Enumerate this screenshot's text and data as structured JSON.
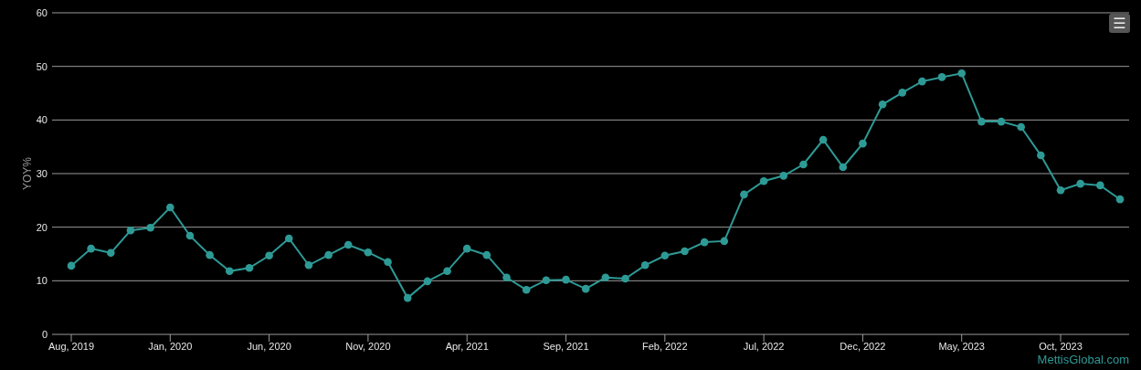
{
  "chart": {
    "menu_button": "☰",
    "credit": "MettisGlobal.com",
    "chart_data": {
      "type": "line",
      "grid": true,
      "ylabel": "YOY%",
      "ylim": [
        0,
        60
      ],
      "yticks": [
        0,
        10,
        20,
        30,
        40,
        50,
        60
      ],
      "categories": [
        "Aug, 2019",
        null,
        null,
        null,
        null,
        "Jan, 2020",
        null,
        null,
        null,
        null,
        "Jun, 2020",
        null,
        null,
        null,
        null,
        "Nov, 2020",
        null,
        null,
        null,
        null,
        "Apr, 2021",
        null,
        null,
        null,
        null,
        "Sep, 2021",
        null,
        null,
        null,
        null,
        "Feb, 2022",
        null,
        null,
        null,
        null,
        "Jul, 2022",
        null,
        null,
        null,
        null,
        "Dec, 2022",
        null,
        null,
        null,
        null,
        "May, 2023",
        null,
        null,
        null,
        null,
        "Oct, 2023",
        null,
        null,
        null
      ],
      "series": [
        {
          "color": "#2e9a96",
          "marker": true,
          "values": [
            12.8,
            16.0,
            15.2,
            19.4,
            19.9,
            23.7,
            18.4,
            14.8,
            11.8,
            12.4,
            14.7,
            17.9,
            12.9,
            14.8,
            16.7,
            15.3,
            13.5,
            6.8,
            9.9,
            11.8,
            16.0,
            14.8,
            10.6,
            8.3,
            10.1,
            10.2,
            8.5,
            10.6,
            10.4,
            12.9,
            14.7,
            15.5,
            17.2,
            17.4,
            26.1,
            28.6,
            29.6,
            31.7,
            36.3,
            31.2,
            35.6,
            42.9,
            45.1,
            47.2,
            48.0,
            48.7,
            39.7,
            39.7,
            38.7,
            33.4,
            26.9,
            28.1,
            27.8,
            25.2
          ]
        }
      ]
    }
  }
}
